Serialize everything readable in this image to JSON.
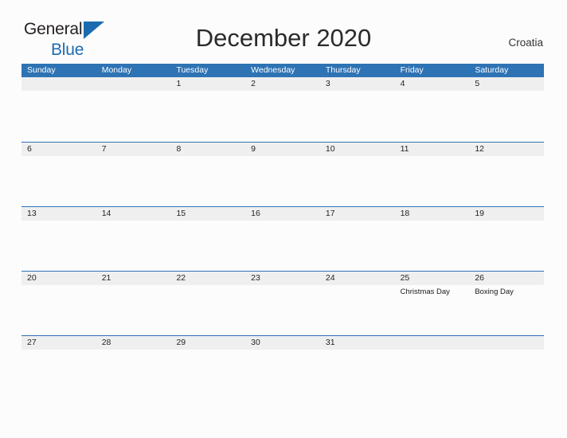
{
  "brand": {
    "word_top": "General",
    "word_bottom": "Blue",
    "triangle_icon": "triangle-icon",
    "accent_color": "#1c6bb0"
  },
  "header": {
    "title": "December 2020",
    "country": "Croatia"
  },
  "theme": {
    "header_blue": "#2e73b4",
    "band_gray": "#efefef",
    "page_background": "#fcfcfc",
    "text_color": "#242424"
  },
  "calendar": {
    "weekdays": [
      "Sunday",
      "Monday",
      "Tuesday",
      "Wednesday",
      "Thursday",
      "Friday",
      "Saturday"
    ],
    "weeks": [
      [
        {
          "day": ""
        },
        {
          "day": ""
        },
        {
          "day": "1",
          "events": []
        },
        {
          "day": "2",
          "events": []
        },
        {
          "day": "3",
          "events": []
        },
        {
          "day": "4",
          "events": []
        },
        {
          "day": "5",
          "events": []
        }
      ],
      [
        {
          "day": "6",
          "events": []
        },
        {
          "day": "7",
          "events": []
        },
        {
          "day": "8",
          "events": []
        },
        {
          "day": "9",
          "events": []
        },
        {
          "day": "10",
          "events": []
        },
        {
          "day": "11",
          "events": []
        },
        {
          "day": "12",
          "events": []
        }
      ],
      [
        {
          "day": "13",
          "events": []
        },
        {
          "day": "14",
          "events": []
        },
        {
          "day": "15",
          "events": []
        },
        {
          "day": "16",
          "events": []
        },
        {
          "day": "17",
          "events": []
        },
        {
          "day": "18",
          "events": []
        },
        {
          "day": "19",
          "events": []
        }
      ],
      [
        {
          "day": "20",
          "events": []
        },
        {
          "day": "21",
          "events": []
        },
        {
          "day": "22",
          "events": []
        },
        {
          "day": "23",
          "events": []
        },
        {
          "day": "24",
          "events": []
        },
        {
          "day": "25",
          "events": [
            "Christmas Day"
          ]
        },
        {
          "day": "26",
          "events": [
            "Boxing Day"
          ]
        }
      ],
      [
        {
          "day": "27",
          "events": []
        },
        {
          "day": "28",
          "events": []
        },
        {
          "day": "29",
          "events": []
        },
        {
          "day": "30",
          "events": []
        },
        {
          "day": "31",
          "events": []
        },
        {
          "day": ""
        },
        {
          "day": ""
        }
      ]
    ]
  }
}
